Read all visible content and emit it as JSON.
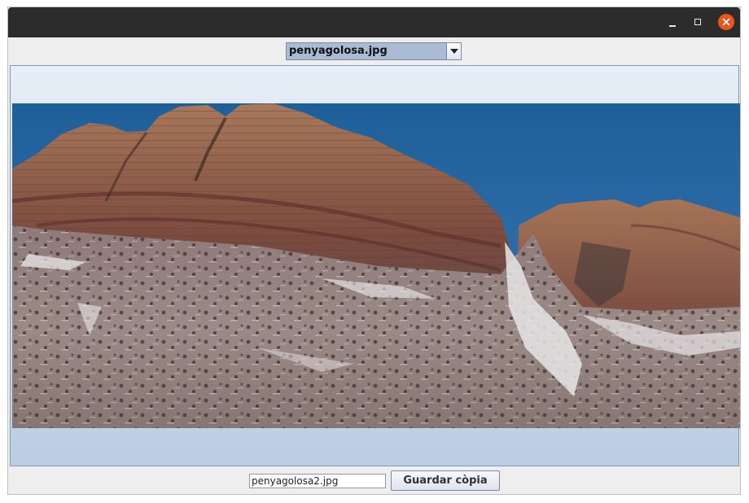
{
  "window": {
    "title": ""
  },
  "selector": {
    "selected": "penyagolosa.jpg"
  },
  "image": {
    "description_icon": "mountain-photo"
  },
  "footer": {
    "filename_value": "penyagolosa2.jpg",
    "save_label": "Guardar còpia"
  }
}
